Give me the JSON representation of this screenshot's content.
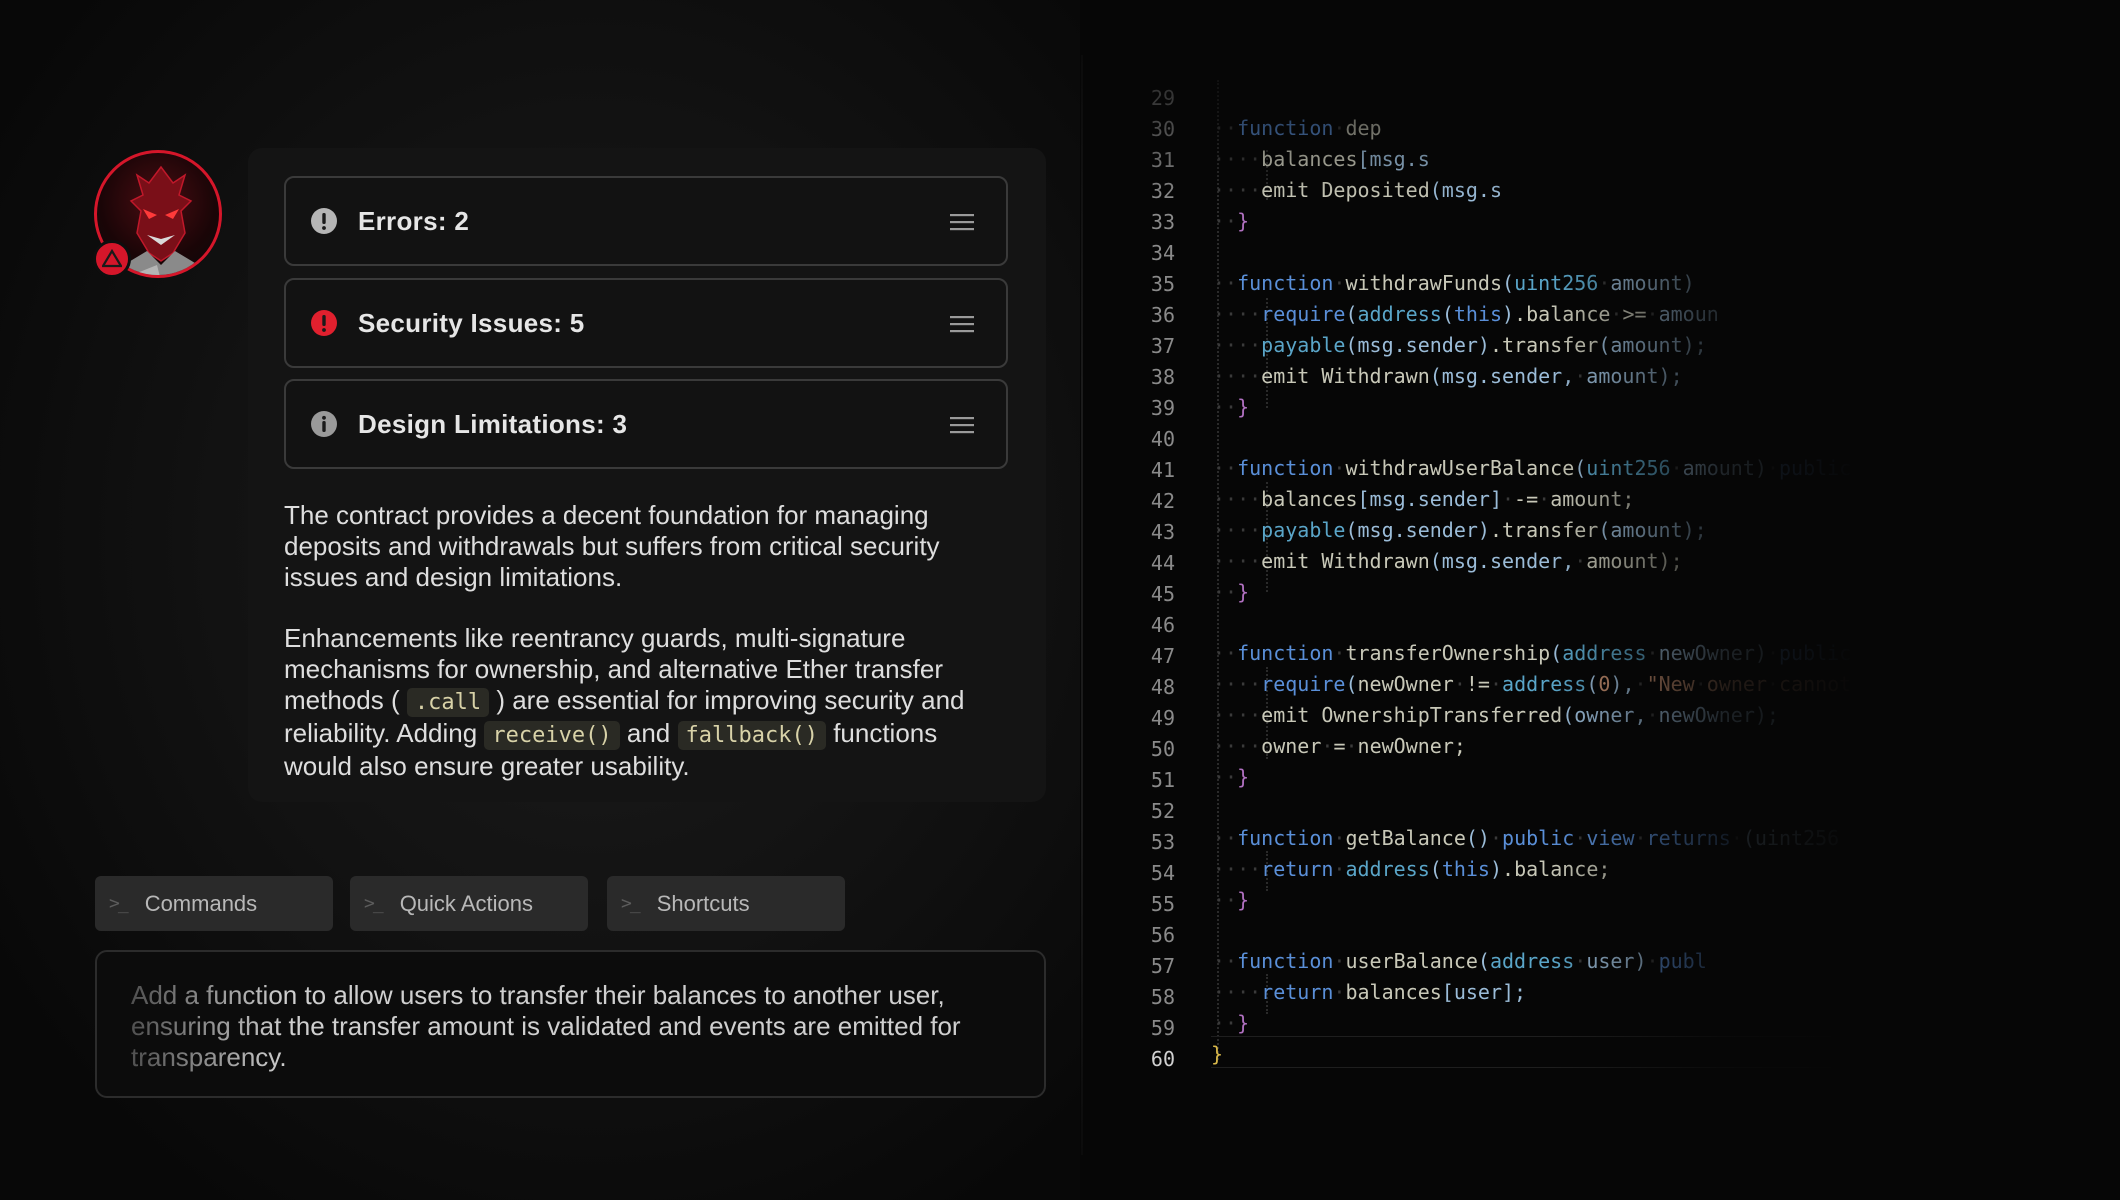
{
  "issues": [
    {
      "label": "Errors: 2",
      "icon": "exclamation-circle-icon",
      "color": "#b5b5b5"
    },
    {
      "label": "Security Issues: 5",
      "icon": "exclamation-circle-icon",
      "color": "#e0202e"
    },
    {
      "label": "Design Limitations: 3",
      "icon": "info-circle-icon",
      "color": "#9a9a9a"
    }
  ],
  "summary": {
    "p1": "The contract provides a decent foundation for managing deposits and withdrawals but suffers from critical security issues and design limitations.",
    "p2_a": "Enhancements like reentrancy guards, multi-signature mechanisms for ownership, and alternative Ether transfer methods (",
    "p2_code1": ".call",
    "p2_b": ") are essential for improving security and reliability. Adding",
    "p2_code2": "receive()",
    "p2_c": "and",
    "p2_code3": "fallback()",
    "p2_d": "functions would also ensure greater usability."
  },
  "buttons": {
    "prompt_symbol": ">_",
    "commands": "Commands",
    "quick_actions": "Quick Actions",
    "shortcuts": "Shortcuts"
  },
  "prompt": {
    "text": "Add a function to allow users to transfer their balances to another user, ensuring that the transfer amount is validated and events are emitted for transparency."
  },
  "colors": {
    "accent": "#d5162a",
    "keyword": "#5a8fd8"
  },
  "editor": {
    "line_numbers": [
      "29",
      "30",
      "31",
      "32",
      "33",
      "34",
      "35",
      "36",
      "37",
      "38",
      "39",
      "40",
      "41",
      "42",
      "43",
      "44",
      "45",
      "46",
      "47",
      "48",
      "49",
      "50",
      "51",
      "52",
      "53",
      "54",
      "55",
      "56",
      "57",
      "58",
      "59",
      "60"
    ]
  }
}
